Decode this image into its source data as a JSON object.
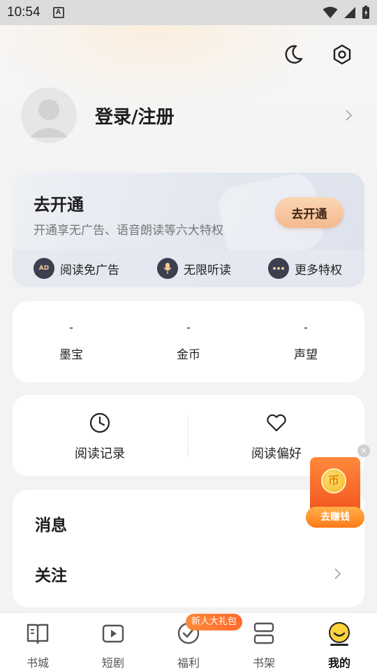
{
  "status_bar": {
    "time": "10:54",
    "a_icon": "A"
  },
  "top_icons": {
    "night": "moon-icon",
    "settings": "settings-icon"
  },
  "profile": {
    "login_label": "登录/注册"
  },
  "vip": {
    "title": "去开通",
    "subtitle": "开通享无广告、语音朗读等六大特权",
    "button": "去开通",
    "features": [
      {
        "label": "阅读免广告",
        "icon": "ad-free-icon",
        "icon_text": "AD"
      },
      {
        "label": "无限听读",
        "icon": "microphone-icon"
      },
      {
        "label": "更多特权",
        "icon": "more-icon"
      }
    ]
  },
  "stats": [
    {
      "value": "-",
      "label": "墨宝"
    },
    {
      "value": "-",
      "label": "金币"
    },
    {
      "value": "-",
      "label": "声望"
    }
  ],
  "records": [
    {
      "label": "阅读记录",
      "icon": "clock-icon"
    },
    {
      "label": "阅读偏好",
      "icon": "heart-icon"
    }
  ],
  "list": [
    {
      "label": "消息"
    },
    {
      "label": "关注"
    }
  ],
  "earn": {
    "coin": "币",
    "button": "去赚钱"
  },
  "tabbar": {
    "badge": "新人大礼包",
    "tabs": [
      {
        "label": "书城",
        "icon": "book-icon"
      },
      {
        "label": "短剧",
        "icon": "play-icon"
      },
      {
        "label": "福利",
        "icon": "check-badge-icon"
      },
      {
        "label": "书架",
        "icon": "shelf-icon"
      },
      {
        "label": "我的",
        "icon": "smile-icon",
        "active": true
      }
    ]
  }
}
